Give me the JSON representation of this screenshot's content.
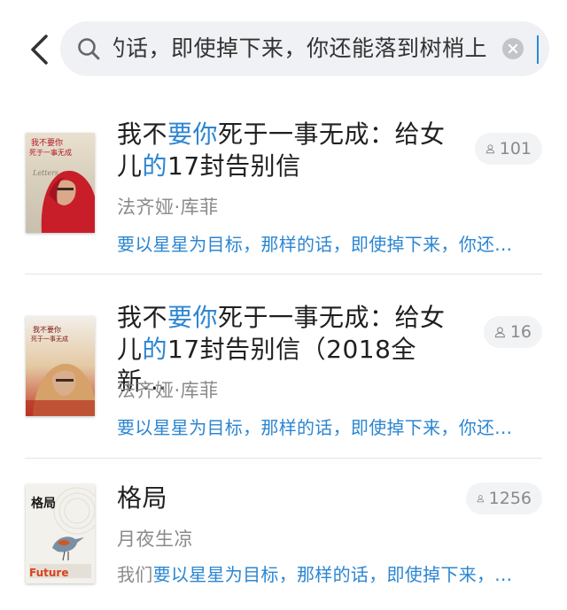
{
  "search": {
    "query": "的话，即使掉下来，你还能落到树梢上"
  },
  "results": [
    {
      "title_part1": "我不",
      "title_hl1": "要你",
      "title_part2": "死于一事无成：给女儿",
      "title_hl2": "的",
      "title_part3": "17封告别信",
      "author": "法齐娅·库菲",
      "snippet": "要以星星为目标，那样的话，即使掉下来，你还...",
      "readers": "101",
      "cover_text": "我不要你死于一事无成"
    },
    {
      "title_part1": "我不",
      "title_hl1": "要你",
      "title_part2": "死于一事无成：给女儿",
      "title_hl2": "的",
      "title_part3": "17封告别信（2018全新...",
      "author": "法齐娅·库菲",
      "snippet": "要以星星为目标，那样的话，即使掉下来，你还...",
      "readers": "16",
      "cover_text": "我不要你死于一事无成"
    },
    {
      "title": "格局",
      "author": "月夜生凉",
      "snippet_prefix": "我们",
      "snippet": "要以星星为目标，那样的话，即使掉下来，...",
      "readers": "1256",
      "cover_text": "格局",
      "cover_word": "Future"
    }
  ],
  "colors": {
    "highlight": "#2c86d1",
    "caret": "#2b88d8"
  }
}
